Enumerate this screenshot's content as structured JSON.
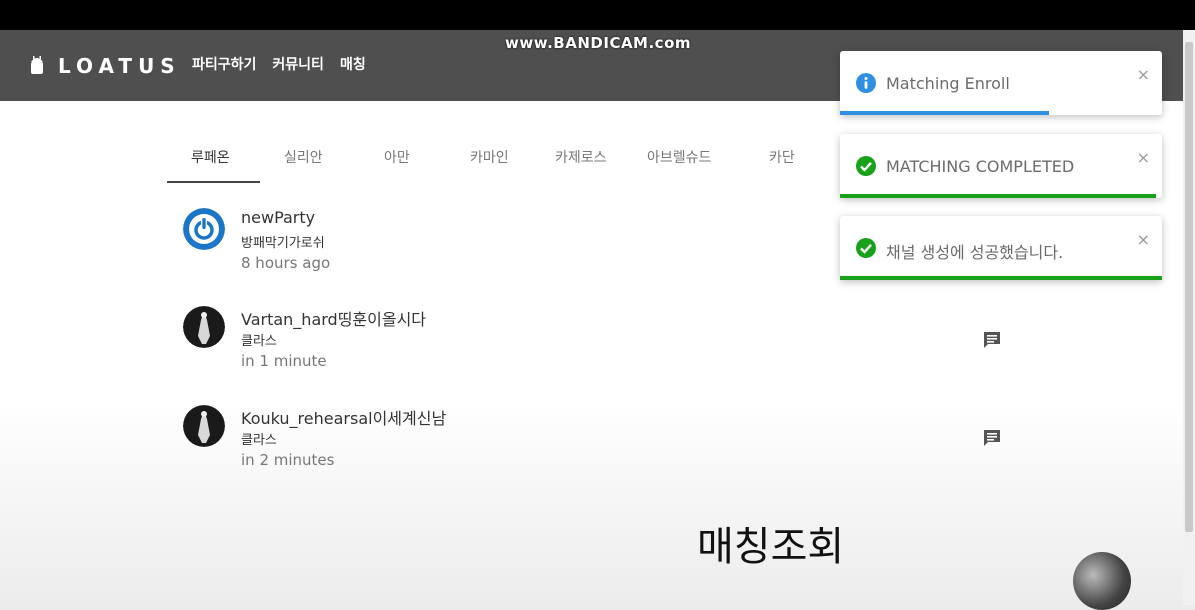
{
  "app": {
    "logo_text": "LOATUS",
    "watermark": "www.BANDICAM.com"
  },
  "nav": {
    "items": [
      "파티구하기",
      "커뮤니티",
      "매칭"
    ]
  },
  "tabs": {
    "items": [
      "루페온",
      "실리안",
      "아만",
      "카마인",
      "카제로스",
      "아브렐슈드",
      "카단"
    ],
    "active_index": 0
  },
  "list": {
    "items": [
      {
        "title": "newParty",
        "subtitle": "방패막기가로쉬",
        "time": "8 hours ago",
        "avatar": "power-icon"
      },
      {
        "title": "Vartan_hard띵훈이올시다",
        "subtitle": "클라스",
        "time": "in 1 minute",
        "avatar": "character-avatar"
      },
      {
        "title": "Kouku_rehearsal이세계신남",
        "subtitle": "클라스",
        "time": "in 2 minutes",
        "avatar": "character-avatar"
      }
    ]
  },
  "toasts": [
    {
      "text": "Matching Enroll",
      "type": "info",
      "color": "#2f8fe0",
      "progress": 0.65
    },
    {
      "text": "MATCHING COMPLETED",
      "type": "success",
      "color": "#1aa11a",
      "progress": 0.98
    },
    {
      "text": "채널 생성에 성공했습니다.",
      "type": "success",
      "color": "#1aa11a",
      "progress": 1.0
    }
  ],
  "toast_close_symbol": "×",
  "caption": "매칭조회",
  "colors": {
    "appbar": "#4f4f4f",
    "info": "#2f8fe0",
    "success": "#1aa11a",
    "avatar_blue": "#1b76c7"
  }
}
